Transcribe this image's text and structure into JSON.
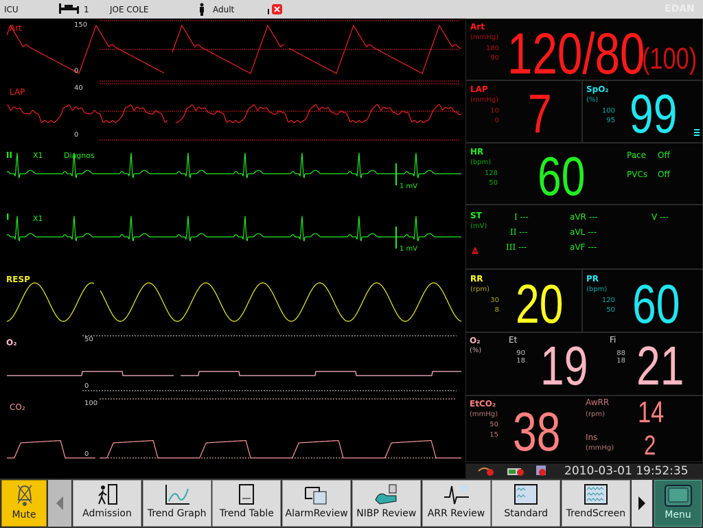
{
  "topbar": {
    "department": "ICU",
    "bed": "1",
    "patient": "JOE COLE",
    "patient_type": "Adult",
    "logo": "EDAN"
  },
  "waves": {
    "art": {
      "label": "Art",
      "scale_high": "150",
      "scale_low": "0"
    },
    "lap": {
      "label": "LAP",
      "scale_high": "40",
      "scale_low": "0"
    },
    "ecg2": {
      "label": "II",
      "gain": "X1",
      "filter": "Diagnos",
      "cal": "1 mV"
    },
    "ecg1": {
      "label": "I",
      "gain": "X1",
      "cal": "1 mV"
    },
    "resp": {
      "label": "RESP"
    },
    "o2": {
      "label": "O₂",
      "scale_high": "50",
      "scale_low": "0"
    },
    "co2": {
      "label": "CO₂",
      "scale_high": "100",
      "scale_low": "0"
    }
  },
  "params": {
    "art": {
      "label": "Art",
      "unit": "(mmHg)",
      "hi": "180",
      "lo": "90",
      "value": "120/80",
      "mean": "(100)",
      "color": "#ff1a1a"
    },
    "lap": {
      "label": "LAP",
      "unit": "(mmHg)",
      "hi": "10",
      "lo": "0",
      "value": "7",
      "color": "#ff1a1a"
    },
    "spo2": {
      "label": "SpO₂",
      "unit": "(%)",
      "hi": "100",
      "lo": "95",
      "value": "99",
      "color": "#22e5ee"
    },
    "hr": {
      "label": "HR",
      "unit": "(bpm)",
      "hi": "128",
      "lo": "50",
      "value": "60",
      "pace_label": "Pace",
      "pace_value": "Off",
      "pvcs_label": "PVCs",
      "pvcs_value": "Off",
      "color": "#22ee22"
    },
    "st": {
      "label": "ST",
      "unit": "(mV)",
      "leads": [
        [
          "I ---",
          "aVR ---",
          "V ---"
        ],
        [
          "II ---",
          "aVL ---"
        ],
        [
          "III ---",
          "aVF ---"
        ]
      ]
    },
    "rr": {
      "label": "RR",
      "unit": "(rpm)",
      "hi": "30",
      "lo": "8",
      "value": "20",
      "color": "#ffff22"
    },
    "pr": {
      "label": "PR",
      "unit": "(bpm)",
      "hi": "120",
      "lo": "50",
      "value": "60",
      "color": "#22e5ee"
    },
    "o2": {
      "label": "O₂",
      "unit": "(%)",
      "et_label": "Et",
      "et_hi": "90",
      "et_lo": "18",
      "et_value": "19",
      "fi_label": "Fi",
      "fi_hi": "88",
      "fi_lo": "18",
      "fi_value": "21",
      "color": "#ffb6c1"
    },
    "etco2": {
      "label": "EtCO₂",
      "unit": "(mmHg)",
      "hi": "50",
      "lo": "15",
      "value": "38",
      "awrr_label": "AwRR",
      "awrr_unit": "(rpm)",
      "awrr_value": "14",
      "ins_label": "Ins",
      "ins_unit": "(mmHg)",
      "ins_value": "2",
      "color": "#ff8080"
    }
  },
  "status": {
    "datetime": "2010-03-01 19:52:35"
  },
  "toolbar": {
    "mute": "Mute",
    "buttons": [
      "Admission",
      "Trend Graph",
      "Trend Table",
      "AlarmReview",
      "NIBP Review",
      "ARR Review",
      "Standard",
      "TrendScreen"
    ],
    "menu": "Menu"
  }
}
